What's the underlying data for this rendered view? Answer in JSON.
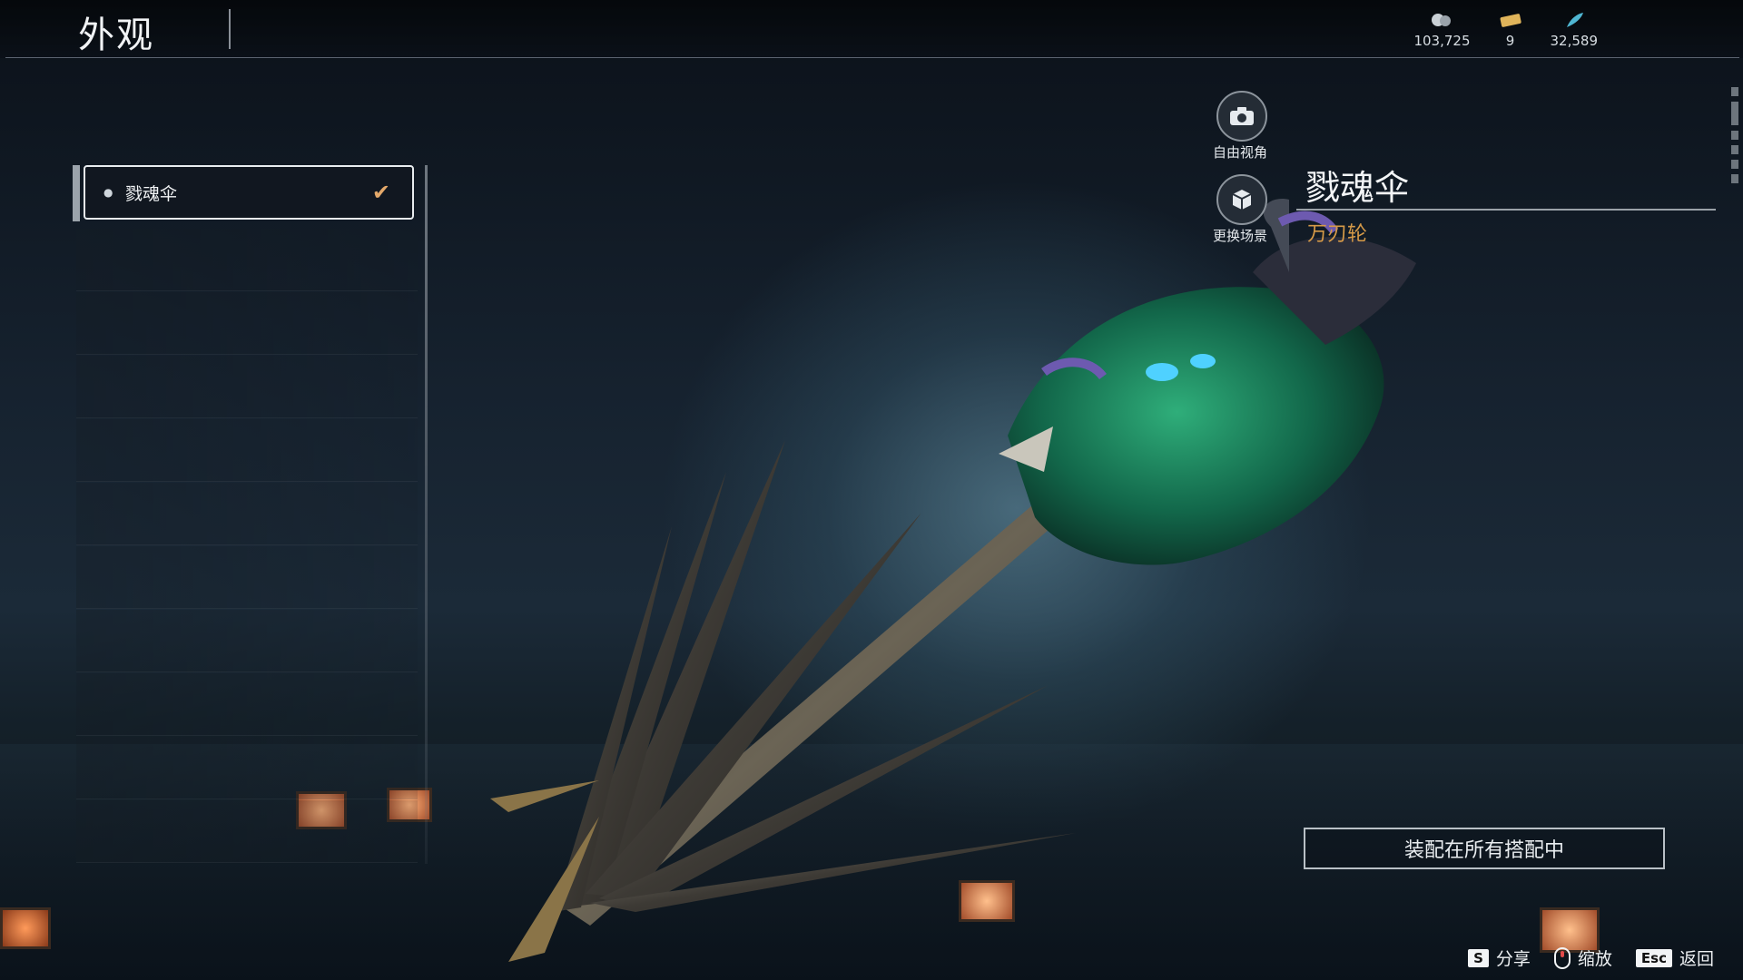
{
  "header": {
    "title": "外观"
  },
  "currencies": [
    {
      "icon": "silver-coin-icon",
      "value": "103,725",
      "color": "#c9d0d6"
    },
    {
      "icon": "ticket-icon",
      "value": "9",
      "color": "#e0b45a"
    },
    {
      "icon": "feather-icon",
      "value": "32,589",
      "color": "#4fb6d2"
    }
  ],
  "skin_list": {
    "items": [
      {
        "label": "戮魂伞",
        "selected": true
      }
    ]
  },
  "camera_buttons": {
    "free_view": "自由视角",
    "change_scene": "更换场景"
  },
  "item": {
    "name": "戮魂伞",
    "subtitle": "万刃轮"
  },
  "equip_button": "装配在所有搭配中",
  "hints": [
    {
      "key": "S",
      "label": "分享"
    },
    {
      "key": "mouse",
      "label": "缩放"
    },
    {
      "key": "Esc",
      "label": "返回"
    }
  ],
  "colors": {
    "accent_orange": "#d69a48",
    "check": "#e3a86a"
  }
}
